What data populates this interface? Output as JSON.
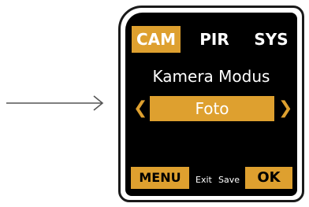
{
  "tabs": [
    {
      "label": "CAM",
      "active": true
    },
    {
      "label": "PIR",
      "active": false
    },
    {
      "label": "SYS",
      "active": false
    }
  ],
  "setting": {
    "title": "Kamera Modus",
    "value": "Foto",
    "prev_glyph": "❮",
    "next_glyph": "❯"
  },
  "footer": {
    "menu_label": "MENU",
    "exit_label": "Exit",
    "save_label": "Save",
    "ok_label": "OK"
  },
  "colors": {
    "accent": "#dea02f",
    "screen": "#000000",
    "bezel": "#1a1a1a"
  },
  "icons": {
    "pointer": "arrow-right-icon",
    "prev": "chevron-left-icon",
    "next": "chevron-right-icon"
  }
}
